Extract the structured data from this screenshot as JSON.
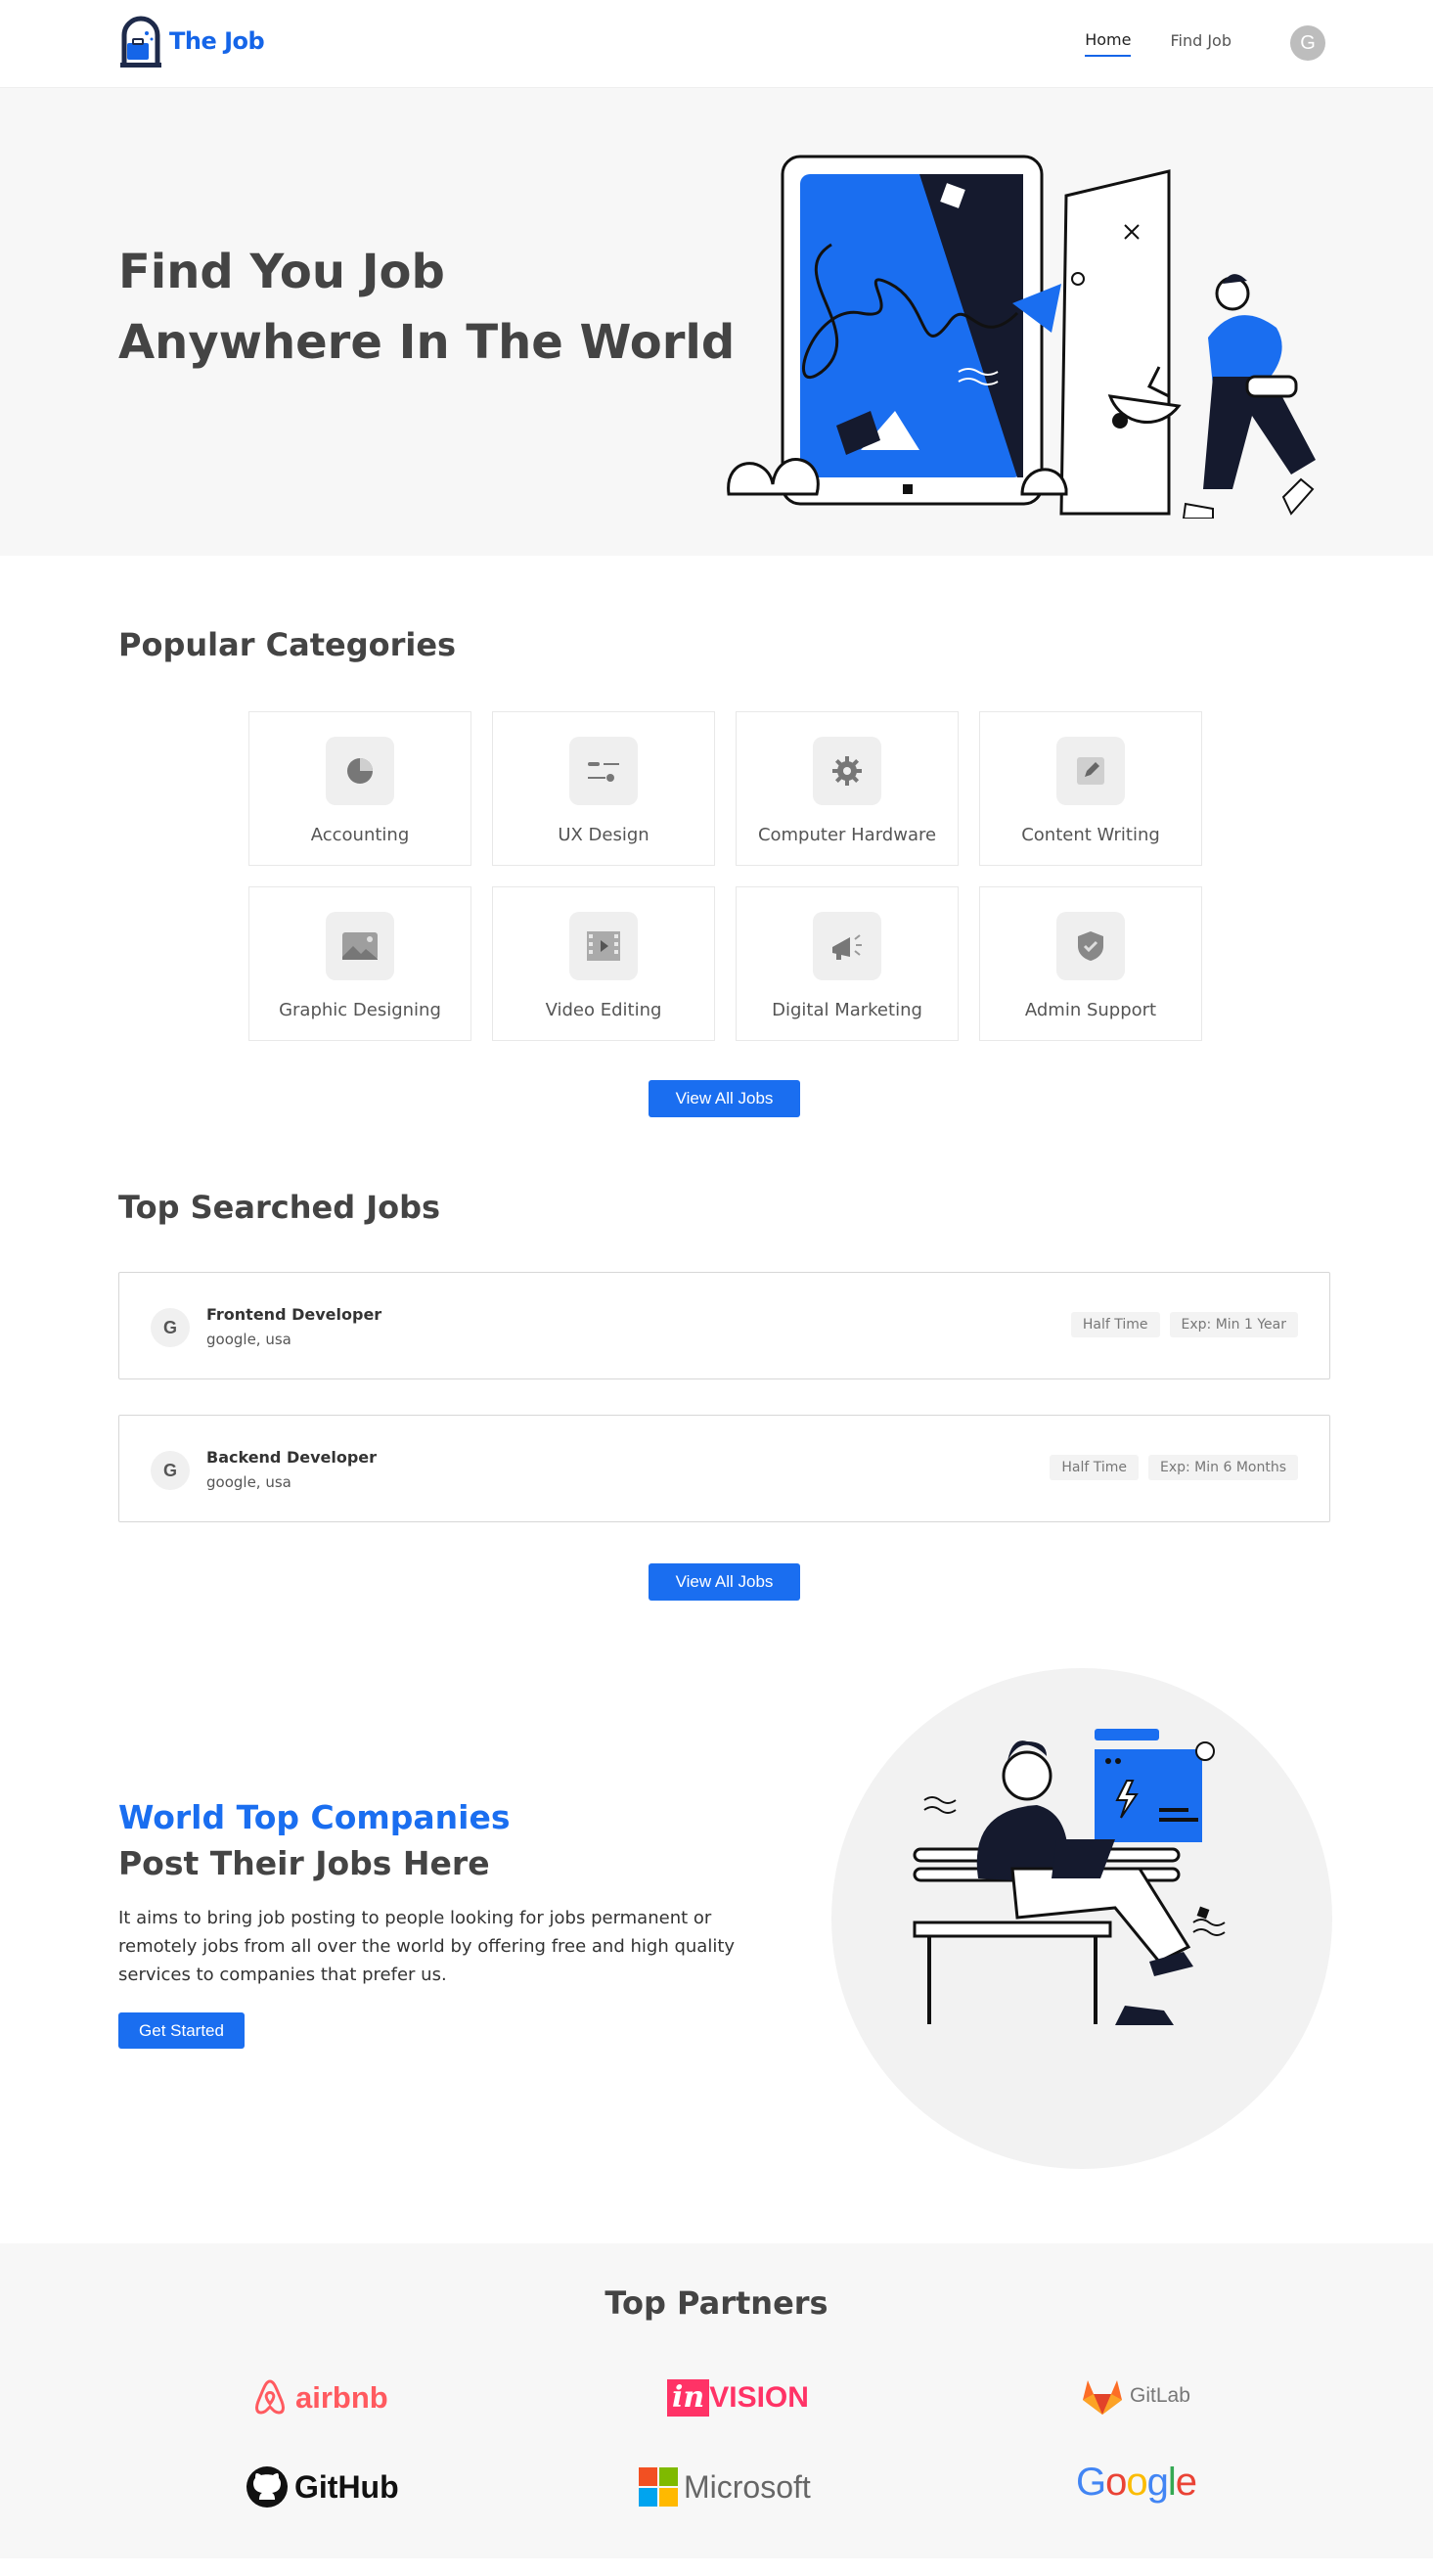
{
  "nav": {
    "logo_text": "The Job",
    "links": [
      {
        "label": "Home",
        "active": true
      },
      {
        "label": "Find Job",
        "active": false
      }
    ],
    "avatar_initial": "G"
  },
  "hero": {
    "title_line1": "Find You Job",
    "title_line2": "Anywhere In The World"
  },
  "categories": {
    "title": "Popular Categories",
    "items": [
      {
        "label": "Accounting",
        "icon": "pie-chart-icon"
      },
      {
        "label": "UX Design",
        "icon": "sliders-icon"
      },
      {
        "label": "Computer Hardware",
        "icon": "gear-icon"
      },
      {
        "label": "Content Writing",
        "icon": "pencil-icon"
      },
      {
        "label": "Graphic Designing",
        "icon": "image-icon"
      },
      {
        "label": "Video Editing",
        "icon": "film-icon"
      },
      {
        "label": "Digital Marketing",
        "icon": "megaphone-icon"
      },
      {
        "label": "Admin Support",
        "icon": "shield-check-icon"
      }
    ],
    "button_label": "View All Jobs"
  },
  "jobs": {
    "title": "Top Searched Jobs",
    "items": [
      {
        "logo": "G",
        "title": "Frontend Developer",
        "location": "google, usa",
        "tags": [
          "Half Time",
          "Exp: Min 1 Year"
        ]
      },
      {
        "logo": "G",
        "title": "Backend Developer",
        "location": "google, usa",
        "tags": [
          "Half Time",
          "Exp: Min 6 Months"
        ]
      }
    ],
    "button_label": "View All Jobs"
  },
  "companies": {
    "heading1": "World Top Companies",
    "heading2": "Post Their Jobs Here",
    "description": "It aims to bring job posting to people looking for jobs permanent or remotely jobs from all over the world by offering free and high quality services to companies that prefer us.",
    "button_label": "Get Started"
  },
  "partners": {
    "title": "Top Partners",
    "logos": [
      "airbnb",
      "invision",
      "GitLab",
      "GitHub",
      "Microsoft",
      "Google"
    ]
  },
  "colors": {
    "accent": "#1a6ef0",
    "brand": "#1565e8",
    "hero_bg": "#f7f7f7",
    "airbnb": "#ff5a5f",
    "invision": "#ff3366",
    "gitlab": "#fc6d26"
  }
}
